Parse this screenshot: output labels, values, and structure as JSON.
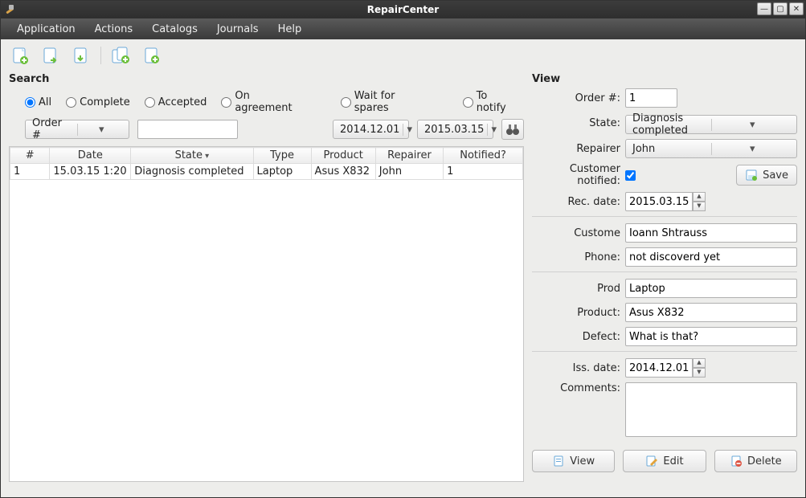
{
  "window": {
    "title": "RepairCenter"
  },
  "menu": [
    "Application",
    "Actions",
    "Catalogs",
    "Journals",
    "Help"
  ],
  "search": {
    "heading": "Search",
    "filters": {
      "all": "All",
      "complete": "Complete",
      "accepted": "Accepted",
      "on_agreement": "On agreement",
      "wait_spares": "Wait for spares",
      "to_notify": "To notify",
      "selected": "all"
    },
    "search_by_label": "Order #",
    "search_value": "",
    "date_from": "2014.12.01",
    "date_to": "2015.03.15"
  },
  "table": {
    "columns": [
      "#",
      "Date",
      "State",
      "Type",
      "Product",
      "Repairer",
      "Notified?"
    ],
    "rows": [
      {
        "num": "1",
        "date": "15.03.15 1:20",
        "state": "Diagnosis completed",
        "type": "Laptop",
        "product": "Asus X832",
        "repairer": "John",
        "notified": "1"
      }
    ]
  },
  "view": {
    "heading": "View",
    "order_label": "Order #:",
    "order_value": "1",
    "state_label": "State:",
    "state_value": "Diagnosis completed",
    "repairer_label": "Repairer",
    "repairer_value": "John",
    "customer_notified_label": "Customer notified:",
    "customer_notified": true,
    "save_label": "Save",
    "rec_date_label": "Rec. date:",
    "rec_date_value": "2015.03.15",
    "customer_label": "Custome",
    "customer_value": "Ioann Shtrauss",
    "phone_label": "Phone:",
    "phone_value": "not discoverd yet",
    "prod_label": "Prod",
    "prod_value": "Laptop",
    "product_label": "Product:",
    "product_value": "Asus X832",
    "defect_label": "Defect:",
    "defect_value": "What is that?",
    "iss_date_label": "Iss. date:",
    "iss_date_value": "2014.12.01",
    "comments_label": "Comments:",
    "comments_value": ""
  },
  "buttons": {
    "view": "View",
    "edit": "Edit",
    "delete": "Delete"
  }
}
